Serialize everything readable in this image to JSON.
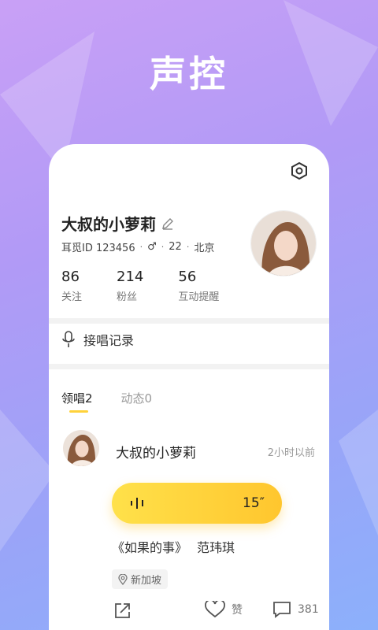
{
  "headline": "声控",
  "profile": {
    "name": "大叔的小萝莉",
    "id_text": "耳觅ID 123456",
    "gender_symbol": "♂",
    "age": "22",
    "city": "北京",
    "separator": "·",
    "stats": [
      {
        "value": "86",
        "label": "关注"
      },
      {
        "value": "214",
        "label": "粉丝"
      },
      {
        "value": "56",
        "label": "互动提醒"
      }
    ]
  },
  "record": {
    "label": "接唱记录"
  },
  "tabs": [
    {
      "label": "领唱2",
      "active": true
    },
    {
      "label": "动态0",
      "active": false
    }
  ],
  "post": {
    "author": "大叔的小萝莉",
    "time": "2小时以前",
    "duration": "15″",
    "song_title": "《如果的事》",
    "singer": "范玮琪",
    "location": "新加坡",
    "like_label": "赞",
    "comment_count": "381"
  },
  "colors": {
    "accent_yellow": "#ffd23a",
    "bg_purple": "#b19af6"
  }
}
